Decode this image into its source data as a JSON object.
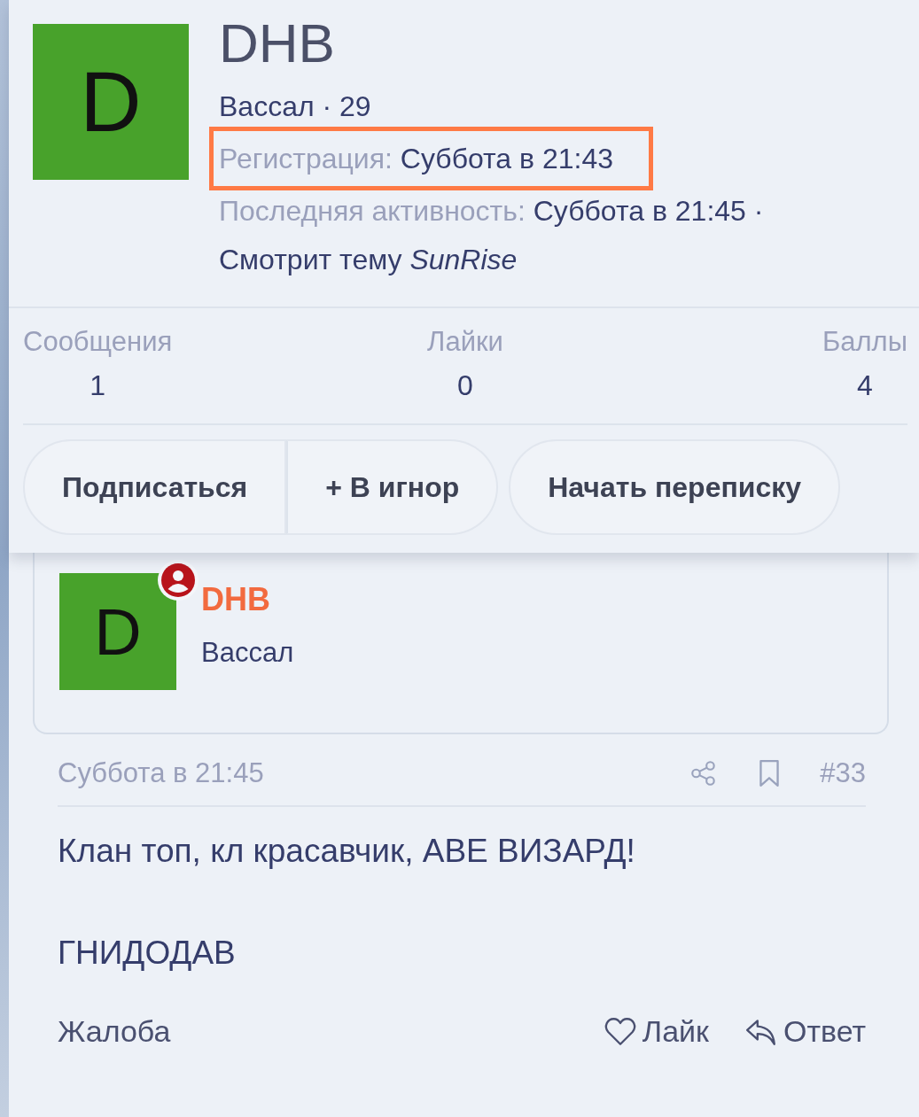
{
  "profile": {
    "avatar_letter": "D",
    "name": "DHB",
    "title_line": "Вассал · 29",
    "registration": {
      "label": "Регистрация:",
      "value": "Суббота в 21:43",
      "highlighted": true
    },
    "last_activity": {
      "label": "Последняя активность:",
      "value": "Суббота в 21:45 ·"
    },
    "viewing": "Смотрит тему *SunRise*"
  },
  "stats": [
    {
      "label": "Сообщения",
      "value": "1"
    },
    {
      "label": "Лайки",
      "value": "0"
    },
    {
      "label": "Баллы",
      "value": "4"
    }
  ],
  "button_groups": [
    [
      "Подписаться",
      "+ В игнор"
    ],
    [
      "Начать переписку"
    ]
  ],
  "post": {
    "author": {
      "avatar_letter": "D",
      "name": "DHB",
      "title": "Вассал"
    },
    "date": "Суббота в 21:45",
    "number": "#33",
    "body": [
      "Клан топ, кл красавчик, АВЕ ВИЗАРД!",
      "ГНИДОДАВ"
    ],
    "actions": {
      "report": "Жалоба",
      "like": "Лайк",
      "reply": "Ответ"
    }
  }
}
